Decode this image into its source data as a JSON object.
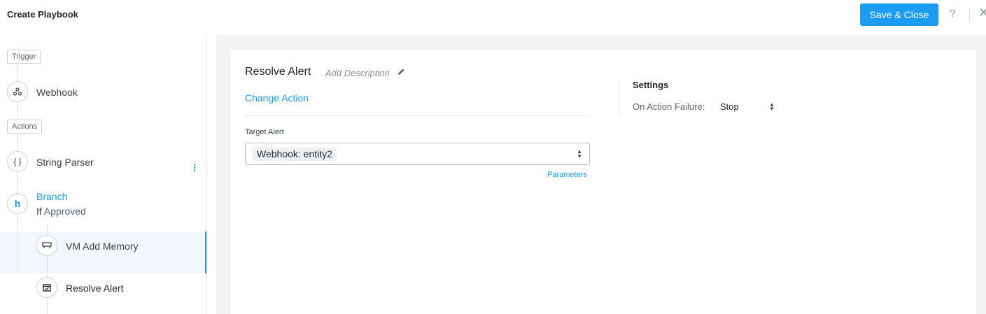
{
  "header": {
    "title": "Create Playbook",
    "save_label": "Save & Close",
    "help_glyph": "?",
    "close_glyph": "✕"
  },
  "sidebar": {
    "trigger_tag": "Trigger",
    "actions_tag": "Actions",
    "nodes": {
      "webhook": {
        "label": "Webhook",
        "icon": "webhook-icon"
      },
      "string_parser": {
        "label": "String Parser",
        "icon": "braces-icon"
      },
      "branch": {
        "label": "Branch",
        "condition_prefix": "If",
        "condition": "Approved",
        "icon": "branch-icon"
      },
      "vm_add_memory": {
        "label": "VM Add Memory",
        "icon": "memory-icon"
      },
      "resolve_alert": {
        "label": "Resolve Alert",
        "icon": "resolve-alert-icon",
        "selected": true
      }
    }
  },
  "editor": {
    "action_title": "Resolve Alert",
    "add_description": "Add Description",
    "change_action": "Change Action",
    "target_alert_label": "Target Alert",
    "target_alert_value": "Webhook: entity2",
    "parameters_link": "Parameters"
  },
  "settings": {
    "title": "Settings",
    "on_failure_label": "On Action Failure:",
    "on_failure_value": "Stop"
  },
  "colors": {
    "accent": "#1b9cf2",
    "canvas_bg": "#f2f3f5",
    "selected_bg": "#f1f7fd"
  }
}
